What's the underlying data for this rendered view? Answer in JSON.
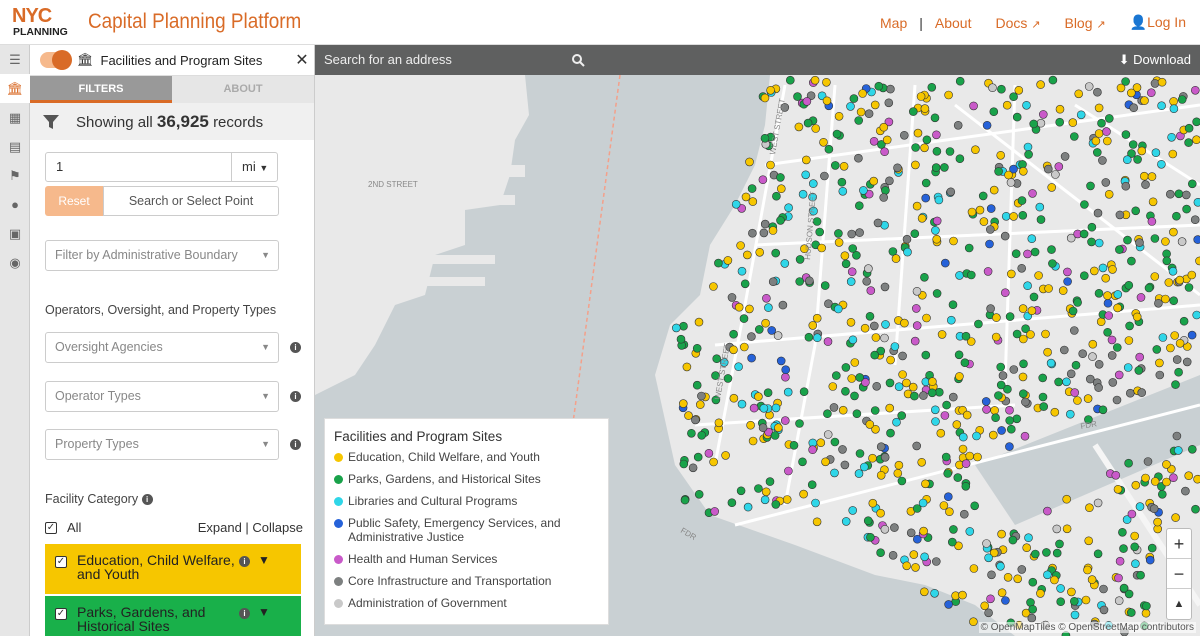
{
  "header": {
    "logo_top": "NYC",
    "logo_bottom": "PLANNING",
    "title": "Capital Planning Platform",
    "nav": {
      "map": "Map",
      "about": "About",
      "docs": "Docs",
      "blog": "Blog",
      "login": "Log In"
    }
  },
  "rail": {
    "items": [
      "list-icon",
      "facilities-icon",
      "map-icon",
      "document-icon",
      "flag-icon",
      "drop-icon",
      "train-icon",
      "camera-icon"
    ]
  },
  "layer": {
    "title": "Facilities and Program Sites",
    "tabs": {
      "filters": "FILTERS",
      "about": "ABOUT"
    },
    "showing_prefix": "Showing all",
    "record_count": "36,925",
    "showing_suffix": "records"
  },
  "filters": {
    "distance_value": "1",
    "distance_unit": "mi",
    "reset_label": "Reset",
    "point_label": "Search or Select Point",
    "admin_boundary_placeholder": "Filter by Administrative Boundary",
    "operators_heading": "Operators, Oversight, and Property Types",
    "oversight_placeholder": "Oversight Agencies",
    "operator_types_placeholder": "Operator Types",
    "property_types_placeholder": "Property Types",
    "facility_category_heading": "Facility Category",
    "all_label": "All",
    "expand_collapse": "Expand | Collapse",
    "categories": [
      {
        "label": "Education, Child Welfare, and Youth",
        "color": "#f6c600"
      },
      {
        "label": "Parks, Gardens, and Historical Sites",
        "color": "#19b04a"
      }
    ]
  },
  "map": {
    "search_placeholder": "Search for an address",
    "download_label": "Download",
    "attribution": "© OpenMapTiles © OpenStreetMap contributors",
    "street_labels": [
      "2ND STREET",
      "WEST STREET",
      "HUDSON STREET",
      "FDR",
      "FDR",
      "WEST STREET"
    ],
    "legend": {
      "title": "Facilities and Program Sites",
      "items": [
        {
          "label": "Education, Child Welfare, and Youth",
          "color": "#f6c600"
        },
        {
          "label": "Parks, Gardens, and Historical Sites",
          "color": "#19a24a"
        },
        {
          "label": "Libraries and Cultural Programs",
          "color": "#2fd6e8"
        },
        {
          "label": "Public Safety, Emergency Services, and Administrative Justice",
          "color": "#2662d9"
        },
        {
          "label": "Health and Human Services",
          "color": "#c95ac9"
        },
        {
          "label": "Core Infrastructure and Transportation",
          "color": "#7d8080"
        },
        {
          "label": "Administration of Government",
          "color": "#c9c9c9"
        }
      ]
    },
    "zoom": {
      "in": "+",
      "out": "−",
      "compass": "▲"
    }
  }
}
